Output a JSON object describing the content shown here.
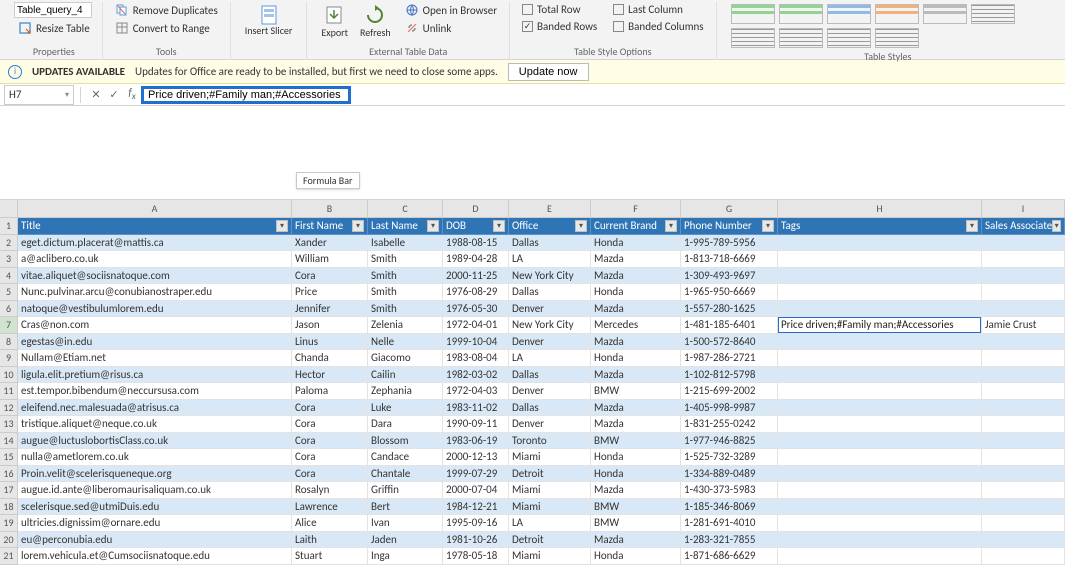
{
  "ribbon": {
    "table_name": "Table_query_4",
    "resize_table": "Resize Table",
    "properties_label": "Properties",
    "remove_duplicates": "Remove Duplicates",
    "convert_to_range": "Convert to Range",
    "tools_label": "Tools",
    "insert_slicer": "Insert Slicer",
    "export": "Export",
    "refresh": "Refresh",
    "open_in_browser": "Open in Browser",
    "unlink": "Unlink",
    "ext_data_label": "External Table Data",
    "total_row": "Total Row",
    "last_column": "Last Column",
    "banded_rows": "Banded Rows",
    "banded_columns": "Banded Columns",
    "style_options_label": "Table Style Options",
    "table_styles_label": "Table Styles"
  },
  "update_bar": {
    "title": "UPDATES AVAILABLE",
    "msg": "Updates for Office are ready to be installed, but first we need to close some apps.",
    "btn": "Update now"
  },
  "formula_bar": {
    "namebox": "H7",
    "formula": "Price driven;#Family man;#Accessories",
    "tooltip": "Formula Bar"
  },
  "columns": [
    "A",
    "B",
    "C",
    "D",
    "E",
    "F",
    "G",
    "H",
    "I"
  ],
  "headers": {
    "title": "Title",
    "first": "First Name",
    "last": "Last Name",
    "dob": "DOB",
    "office": "Office",
    "brand": "Current Brand",
    "phone": "Phone Number",
    "tags": "Tags",
    "assoc": "Sales Associate"
  },
  "selected_row": 7,
  "rows": [
    {
      "n": 2,
      "title": "eget.dictum.placerat@mattis.ca",
      "first": "Xander",
      "last": "Isabelle",
      "dob": "1988-08-15",
      "office": "Dallas",
      "brand": "Honda",
      "phone": "1-995-789-5956",
      "tags": "",
      "assoc": ""
    },
    {
      "n": 3,
      "title": "a@aclibero.co.uk",
      "first": "William",
      "last": "Smith",
      "dob": "1989-04-28",
      "office": "LA",
      "brand": "Mazda",
      "phone": "1-813-718-6669",
      "tags": "",
      "assoc": ""
    },
    {
      "n": 4,
      "title": "vitae.aliquet@sociisnatoque.com",
      "first": "Cora",
      "last": "Smith",
      "dob": "2000-11-25",
      "office": "New York City",
      "brand": "Mazda",
      "phone": "1-309-493-9697",
      "tags": "",
      "assoc": ""
    },
    {
      "n": 5,
      "title": "Nunc.pulvinar.arcu@conubianostraper.edu",
      "first": "Price",
      "last": "Smith",
      "dob": "1976-08-29",
      "office": "Dallas",
      "brand": "Honda",
      "phone": "1-965-950-6669",
      "tags": "",
      "assoc": ""
    },
    {
      "n": 6,
      "title": "natoque@vestibulumlorem.edu",
      "first": "Jennifer",
      "last": "Smith",
      "dob": "1976-05-30",
      "office": "Denver",
      "brand": "Mazda",
      "phone": "1-557-280-1625",
      "tags": "",
      "assoc": ""
    },
    {
      "n": 7,
      "title": "Cras@non.com",
      "first": "Jason",
      "last": "Zelenia",
      "dob": "1972-04-01",
      "office": "New York City",
      "brand": "Mercedes",
      "phone": "1-481-185-6401",
      "tags": "Price driven;#Family man;#Accessories",
      "assoc": "Jamie Crust"
    },
    {
      "n": 8,
      "title": "egestas@in.edu",
      "first": "Linus",
      "last": "Nelle",
      "dob": "1999-10-04",
      "office": "Denver",
      "brand": "Mazda",
      "phone": "1-500-572-8640",
      "tags": "",
      "assoc": ""
    },
    {
      "n": 9,
      "title": "Nullam@Etiam.net",
      "first": "Chanda",
      "last": "Giacomo",
      "dob": "1983-08-04",
      "office": "LA",
      "brand": "Honda",
      "phone": "1-987-286-2721",
      "tags": "",
      "assoc": ""
    },
    {
      "n": 10,
      "title": "ligula.elit.pretium@risus.ca",
      "first": "Hector",
      "last": "Cailin",
      "dob": "1982-03-02",
      "office": "Dallas",
      "brand": "Mazda",
      "phone": "1-102-812-5798",
      "tags": "",
      "assoc": ""
    },
    {
      "n": 11,
      "title": "est.tempor.bibendum@neccursusa.com",
      "first": "Paloma",
      "last": "Zephania",
      "dob": "1972-04-03",
      "office": "Denver",
      "brand": "BMW",
      "phone": "1-215-699-2002",
      "tags": "",
      "assoc": ""
    },
    {
      "n": 12,
      "title": "eleifend.nec.malesuada@atrisus.ca",
      "first": "Cora",
      "last": "Luke",
      "dob": "1983-11-02",
      "office": "Dallas",
      "brand": "Mazda",
      "phone": "1-405-998-9987",
      "tags": "",
      "assoc": ""
    },
    {
      "n": 13,
      "title": "tristique.aliquet@neque.co.uk",
      "first": "Cora",
      "last": "Dara",
      "dob": "1990-09-11",
      "office": "Denver",
      "brand": "Mazda",
      "phone": "1-831-255-0242",
      "tags": "",
      "assoc": ""
    },
    {
      "n": 14,
      "title": "augue@luctuslobortisClass.co.uk",
      "first": "Cora",
      "last": "Blossom",
      "dob": "1983-06-19",
      "office": "Toronto",
      "brand": "BMW",
      "phone": "1-977-946-8825",
      "tags": "",
      "assoc": ""
    },
    {
      "n": 15,
      "title": "nulla@ametlorem.co.uk",
      "first": "Cora",
      "last": "Candace",
      "dob": "2000-12-13",
      "office": "Miami",
      "brand": "Honda",
      "phone": "1-525-732-3289",
      "tags": "",
      "assoc": ""
    },
    {
      "n": 16,
      "title": "Proin.velit@scelerisqueneque.org",
      "first": "Cora",
      "last": "Chantale",
      "dob": "1999-07-29",
      "office": "Detroit",
      "brand": "Honda",
      "phone": "1-334-889-0489",
      "tags": "",
      "assoc": ""
    },
    {
      "n": 17,
      "title": "augue.id.ante@liberomaurisaliquam.co.uk",
      "first": "Rosalyn",
      "last": "Griffin",
      "dob": "2000-07-04",
      "office": "Miami",
      "brand": "Mazda",
      "phone": "1-430-373-5983",
      "tags": "",
      "assoc": ""
    },
    {
      "n": 18,
      "title": "scelerisque.sed@utmiDuis.edu",
      "first": "Lawrence",
      "last": "Bert",
      "dob": "1984-12-21",
      "office": "Miami",
      "brand": "BMW",
      "phone": "1-185-346-8069",
      "tags": "",
      "assoc": ""
    },
    {
      "n": 19,
      "title": "ultricies.dignissim@ornare.edu",
      "first": "Alice",
      "last": "Ivan",
      "dob": "1995-09-16",
      "office": "LA",
      "brand": "BMW",
      "phone": "1-281-691-4010",
      "tags": "",
      "assoc": ""
    },
    {
      "n": 20,
      "title": "eu@perconubia.edu",
      "first": "Laith",
      "last": "Jaden",
      "dob": "1981-10-26",
      "office": "Detroit",
      "brand": "Mazda",
      "phone": "1-283-321-7855",
      "tags": "",
      "assoc": ""
    },
    {
      "n": 21,
      "title": "lorem.vehicula.et@Cumsociisnatoque.edu",
      "first": "Stuart",
      "last": "Inga",
      "dob": "1978-05-18",
      "office": "Miami",
      "brand": "Honda",
      "phone": "1-871-686-6629",
      "tags": "",
      "assoc": ""
    }
  ]
}
